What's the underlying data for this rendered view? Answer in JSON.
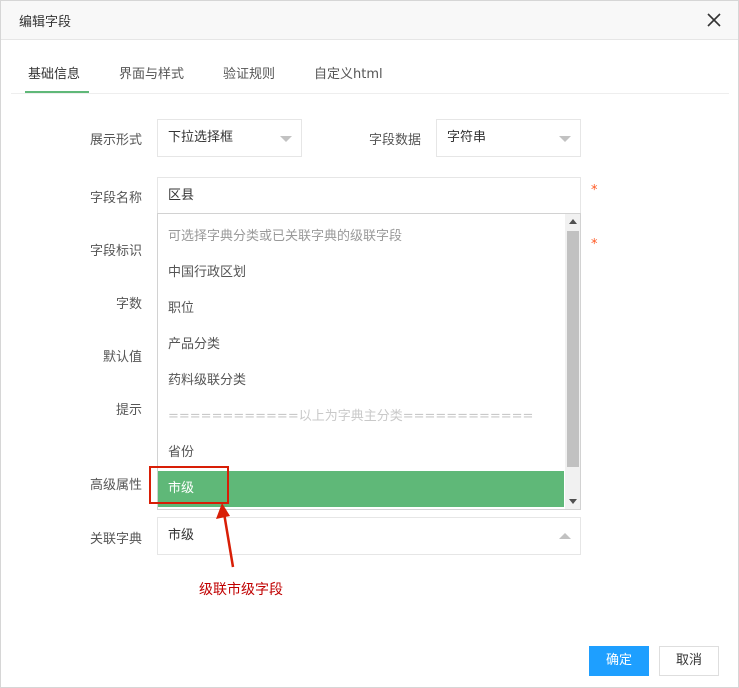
{
  "dialog": {
    "title": "编辑字段"
  },
  "tabs": [
    {
      "label": "基础信息"
    },
    {
      "label": "界面与样式"
    },
    {
      "label": "验证规则"
    },
    {
      "label": "自定义html"
    }
  ],
  "form": {
    "display_form_label": "展示形式",
    "display_form_value": "下拉选择框",
    "field_data_label": "字段数据",
    "field_data_value": "字符串",
    "field_name_label": "字段名称",
    "field_name_value": "区县",
    "field_id_label": "字段标识",
    "char_count_label": "字数",
    "default_label": "默认值",
    "hint_label": "提示",
    "advanced_label": "高级属性",
    "dict_label": "关联字典",
    "dict_value": "市级",
    "required_mark": "*"
  },
  "dropdown": {
    "items": [
      {
        "label": "可选择字典分类或已关联字典的级联字段"
      },
      {
        "label": "中国行政区划"
      },
      {
        "label": "职位"
      },
      {
        "label": "产品分类"
      },
      {
        "label": "药料级联分类"
      },
      {
        "label": "============以上为字典主分类============"
      },
      {
        "label": "省份"
      },
      {
        "label": "市级"
      }
    ]
  },
  "annotation": {
    "text": "级联市级字段",
    "color": "#c00000"
  },
  "buttons": {
    "ok_label": "确定",
    "cancel_label": "取消"
  },
  "colors": {
    "primary": "#1e9fff",
    "selected": "#5fb878",
    "required": "#ff5722"
  }
}
